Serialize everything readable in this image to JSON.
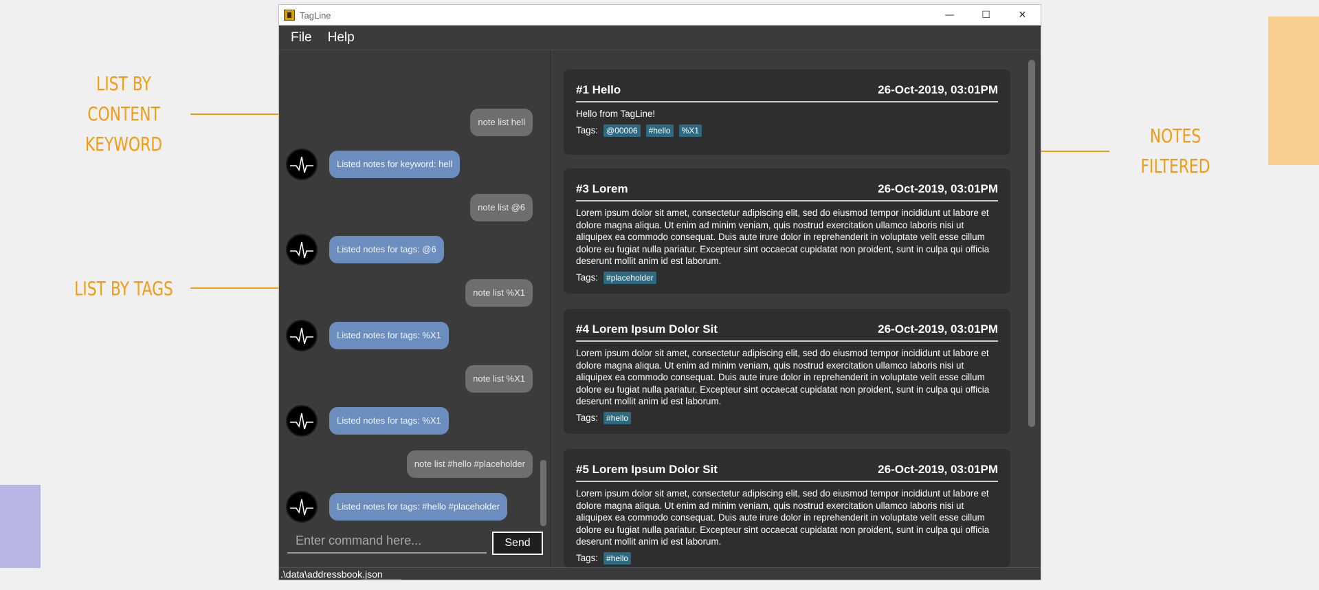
{
  "annotations": {
    "content_keyword": "LIST BY CONTENT KEYWORD",
    "tags": "LIST BY TAGS",
    "notes_filtered": "NOTES FILTERED"
  },
  "window": {
    "title": "TagLine",
    "controls": {
      "minimize": "—",
      "maximize": "☐",
      "close": "✕"
    }
  },
  "menu": [
    "File",
    "Help"
  ],
  "chat": {
    "messages": [
      {
        "from": "user",
        "text": "note list hell"
      },
      {
        "from": "bot",
        "text": "Listed notes for keyword: hell"
      },
      {
        "from": "user",
        "text": "note list @6"
      },
      {
        "from": "bot",
        "text": "Listed notes for tags: @6"
      },
      {
        "from": "user",
        "text": "note list %X1"
      },
      {
        "from": "bot",
        "text": "Listed notes for tags: %X1"
      },
      {
        "from": "user",
        "text": "note list %X1"
      },
      {
        "from": "bot",
        "text": "Listed notes for tags: %X1"
      },
      {
        "from": "user",
        "text": "note list #hello #placeholder"
      },
      {
        "from": "bot",
        "text": "Listed notes for tags: #hello #placeholder"
      }
    ],
    "input_placeholder": "Enter command here...",
    "send_label": "Send"
  },
  "notes": [
    {
      "title": "#1 Hello",
      "date": "26-Oct-2019, 03:01PM",
      "content": "Hello from TagLine!",
      "tags_label": "Tags:",
      "tags": [
        "@00006",
        "#hello",
        "%X1"
      ]
    },
    {
      "title": "#3 Lorem",
      "date": "26-Oct-2019, 03:01PM",
      "content": "Lorem ipsum dolor sit amet, consectetur adipiscing elit, sed do eiusmod tempor incididunt ut labore et dolore magna aliqua. Ut enim ad minim veniam, quis nostrud exercitation ullamco laboris nisi ut aliquipex ea commodo consequat. Duis aute irure dolor in reprehenderit in voluptate velit esse cillum dolore eu fugiat nulla pariatur. Excepteur sint occaecat cupidatat non proident, sunt in culpa qui officia deserunt mollit anim id est laborum.",
      "tags_label": "Tags:",
      "tags": [
        "#placeholder"
      ]
    },
    {
      "title": "#4 Lorem Ipsum Dolor Sit",
      "date": "26-Oct-2019, 03:01PM",
      "content": "Lorem ipsum dolor sit amet, consectetur adipiscing elit, sed do eiusmod tempor incididunt ut labore et dolore magna aliqua. Ut enim ad minim veniam, quis nostrud exercitation ullamco laboris nisi ut aliquipex ea commodo consequat. Duis aute irure dolor in reprehenderit in voluptate velit esse cillum dolore eu fugiat nulla pariatur. Excepteur sint occaecat cupidatat non proident, sunt in culpa qui officia deserunt mollit anim id est laborum.",
      "tags_label": "Tags:",
      "tags": [
        "#hello"
      ]
    },
    {
      "title": "#5 Lorem Ipsum Dolor Sit",
      "date": "26-Oct-2019, 03:01PM",
      "content": "Lorem ipsum dolor sit amet, consectetur adipiscing elit, sed do eiusmod tempor incididunt ut labore et dolore magna aliqua. Ut enim ad minim veniam, quis nostrud exercitation ullamco laboris nisi ut aliquipex ea commodo consequat. Duis aute irure dolor in reprehenderit in voluptate velit esse cillum dolore eu fugiat nulla pariatur. Excepteur sint occaecat cupidatat non proident, sunt in culpa qui officia deserunt mollit anim id est laborum.",
      "tags_label": "Tags:",
      "tags": [
        "#hello"
      ]
    }
  ],
  "status": {
    "file_path": ".\\data\\addressbook.json"
  },
  "colors": {
    "accent_orange": "#f39c12",
    "bot_bubble": "#6c8ebf",
    "user_bubble": "#6e6e6e",
    "tag_bg": "#2d6a82",
    "panel_bg": "#3b3b3b",
    "card_bg": "#2e2e2e"
  }
}
